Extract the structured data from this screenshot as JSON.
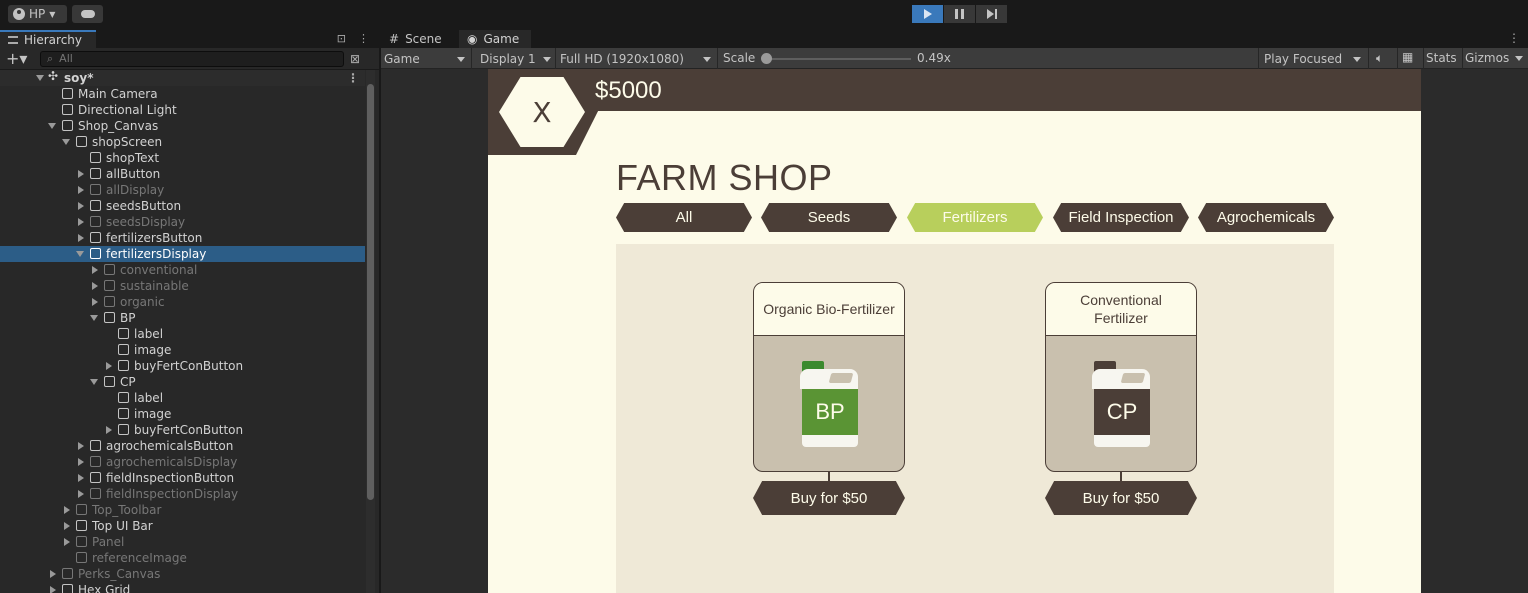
{
  "toolbar": {
    "account": "HP"
  },
  "hierarchy": {
    "tab": "Hierarchy",
    "search_placeholder": "All",
    "items": [
      {
        "label": "soy*"
      },
      {
        "label": "Main Camera"
      },
      {
        "label": "Directional Light"
      },
      {
        "label": "Shop_Canvas"
      },
      {
        "label": "shopScreen"
      },
      {
        "label": "shopText"
      },
      {
        "label": "allButton"
      },
      {
        "label": "allDisplay"
      },
      {
        "label": "seedsButton"
      },
      {
        "label": "seedsDisplay"
      },
      {
        "label": "fertilizersButton"
      },
      {
        "label": "fertilizersDisplay"
      },
      {
        "label": "conventional"
      },
      {
        "label": "sustainable"
      },
      {
        "label": "organic"
      },
      {
        "label": "BP"
      },
      {
        "label": "label"
      },
      {
        "label": "image"
      },
      {
        "label": "buyFertConButton"
      },
      {
        "label": "CP"
      },
      {
        "label": "label"
      },
      {
        "label": "image"
      },
      {
        "label": "buyFertConButton"
      },
      {
        "label": "agrochemicalsButton"
      },
      {
        "label": "agrochemicalsDisplay"
      },
      {
        "label": "fieldInspectionButton"
      },
      {
        "label": "fieldInspectionDisplay"
      },
      {
        "label": "Top_Toolbar"
      },
      {
        "label": "Top UI Bar"
      },
      {
        "label": "Panel"
      },
      {
        "label": "referenceImage"
      },
      {
        "label": "Perks_Canvas"
      },
      {
        "label": "Hex Grid"
      }
    ]
  },
  "game_view": {
    "tabs": [
      "Scene",
      "Game"
    ],
    "view_mode": "Game",
    "display": "Display 1",
    "resolution": "Full HD (1920x1080)",
    "scale_label": "Scale",
    "scale_value": "0.49x",
    "play_mode": "Play Focused",
    "stats": "Stats",
    "gizmos": "Gizmos"
  },
  "shop": {
    "close_glyph": "X",
    "money": "$5000",
    "title": "FARM SHOP",
    "categories": [
      "All",
      "Seeds",
      "Fertilizers",
      "Field Inspection",
      "Agrochemicals"
    ],
    "active_category": "Fertilizers",
    "products": [
      {
        "name": "Organic Bio-Fertilizer",
        "code": "BP",
        "buy": "Buy for $50",
        "cap_color": "#3b8a2e",
        "body_color": "#5a9434"
      },
      {
        "name": "Conventional Fertilizer",
        "code": "CP",
        "buy": "Buy for $50",
        "cap_color": "#4b3e37",
        "body_color": "#4b3e37"
      }
    ]
  },
  "colors": {
    "brown": "#4b3e37",
    "cream": "#fdfbe9",
    "active_green": "#b8cf5c",
    "selection": "#2c5d87",
    "play_blue": "#3a79bb"
  }
}
